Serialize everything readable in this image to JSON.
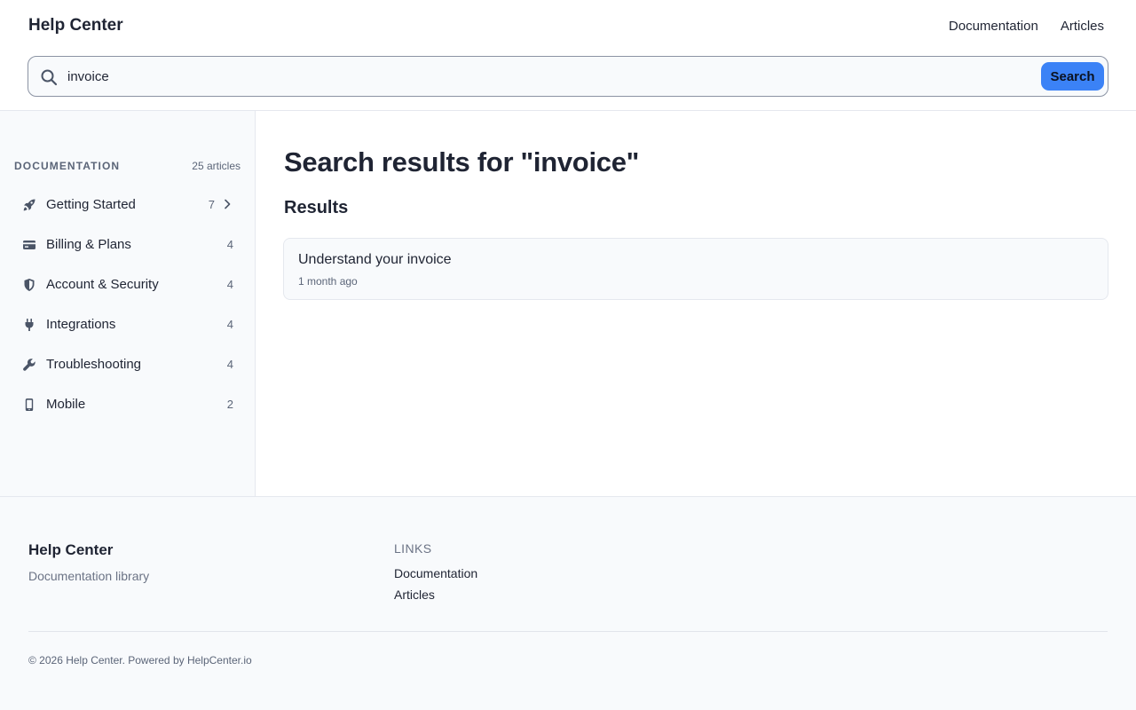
{
  "header": {
    "brand": "Help Center",
    "nav": [
      "Documentation",
      "Articles"
    ]
  },
  "search": {
    "value": "invoice",
    "placeholder": "",
    "button_label": "Search"
  },
  "sidebar": {
    "title": "DOCUMENTATION",
    "count_label": "25 articles",
    "items": [
      {
        "icon": "rocket-icon",
        "label": "Getting Started",
        "count": "7",
        "chevron": true
      },
      {
        "icon": "credit-card-icon",
        "label": "Billing & Plans",
        "count": "4"
      },
      {
        "icon": "shield-icon",
        "label": "Account & Security",
        "count": "4"
      },
      {
        "icon": "plug-icon",
        "label": "Integrations",
        "count": "4"
      },
      {
        "icon": "wrench-icon",
        "label": "Troubleshooting",
        "count": "4"
      },
      {
        "icon": "mobile-icon",
        "label": "Mobile",
        "count": "2"
      }
    ]
  },
  "main": {
    "title": "Search results for \"invoice\"",
    "section_title": "Results",
    "results": [
      {
        "title": "Understand your invoice",
        "meta": "1 month ago"
      }
    ]
  },
  "footer": {
    "brand": "Help Center",
    "tagline": "Documentation library",
    "links_title": "LINKS",
    "links": [
      "Documentation",
      "Articles"
    ],
    "copyright": "© 2026 Help Center. Powered by HelpCenter.io"
  },
  "colors": {
    "accent": "#3b82f6",
    "text": "#1f2433",
    "muted": "#5b6578",
    "surface": "#f8fafc"
  }
}
